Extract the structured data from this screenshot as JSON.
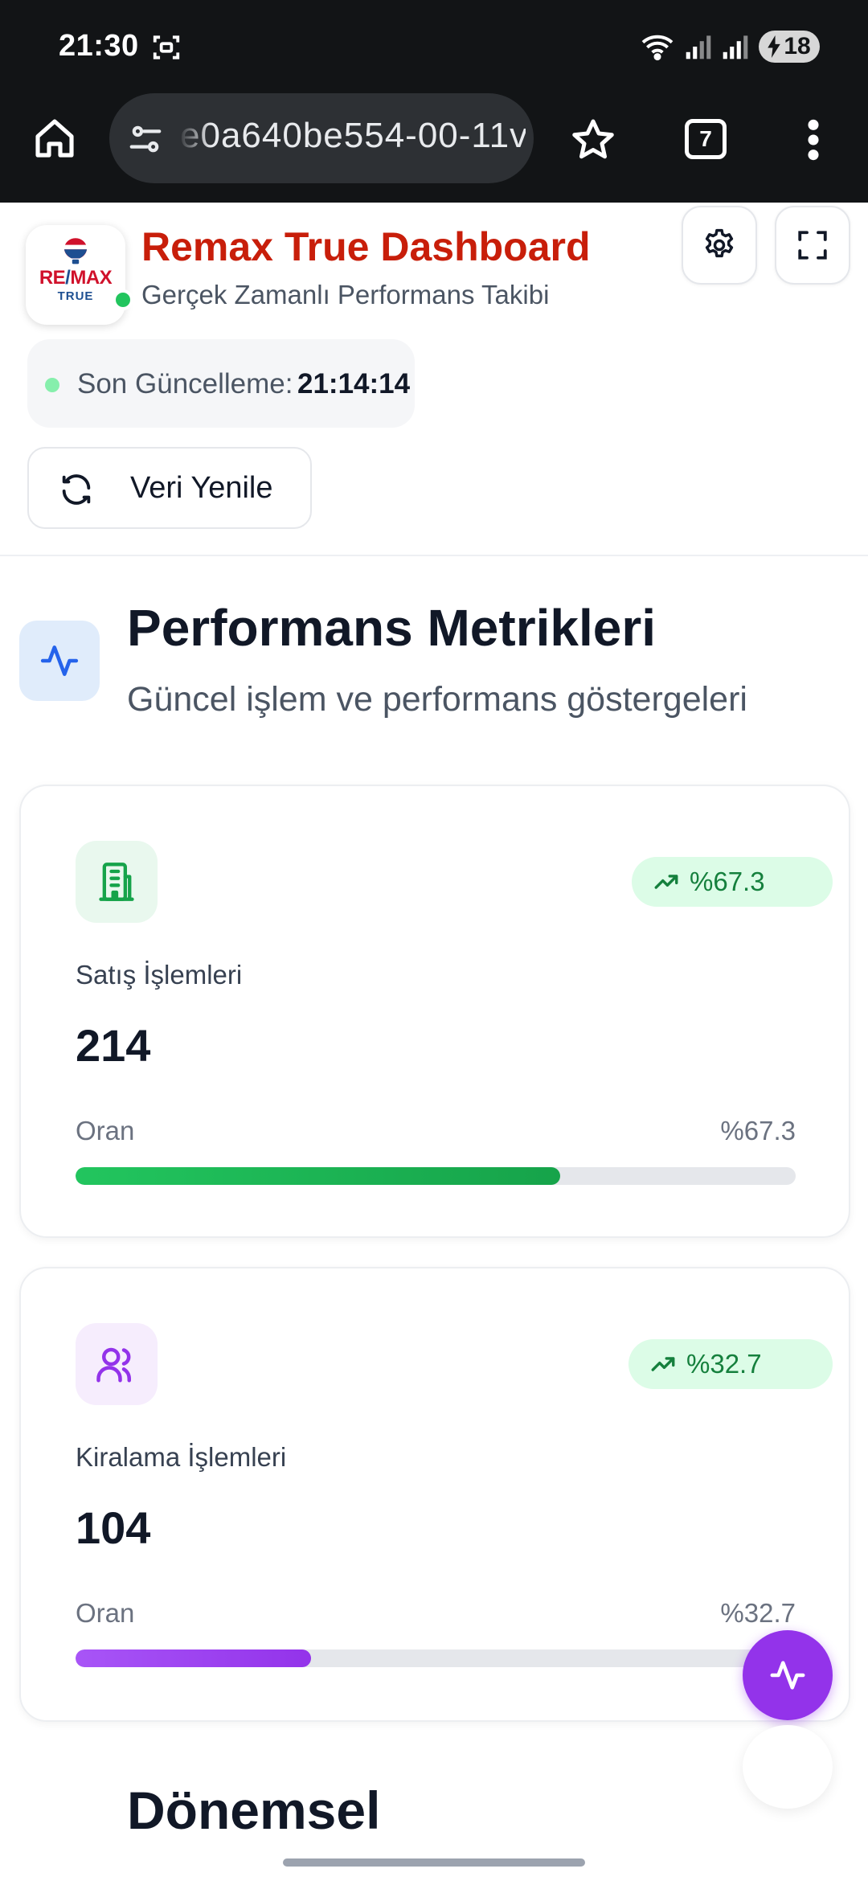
{
  "status_bar": {
    "time": "21:30",
    "battery": "18",
    "icons": [
      "screenshot-icon",
      "wifi-icon",
      "signal-icon",
      "signal-icon",
      "charging-icon"
    ]
  },
  "browser": {
    "url": "e0a640be554-00-11v",
    "tab_count": "7",
    "icons": [
      "home-icon",
      "site-settings-icon",
      "star-icon",
      "more-vert-icon"
    ]
  },
  "header": {
    "logo_re": "RE",
    "logo_slash": "/",
    "logo_max": "MAX",
    "logo_true": "TRUE",
    "title": "Remax True Dashboard",
    "subtitle": "Gerçek Zamanlı Performans Takibi",
    "last_update_label": "Son Güncelleme:",
    "last_update_value": "21:14:14",
    "refresh_label": "Veri Yenile",
    "online_color": "#22c55e",
    "brand_color": "#c81e0a"
  },
  "section": {
    "title": "Performans Metrikleri",
    "subtitle": "Güncel işlem ve performans göstergeleri",
    "icon": "activity-icon"
  },
  "metrics": [
    {
      "icon": "building-icon",
      "trend": "%67.3",
      "label": "Satış İşlemleri",
      "value": "214",
      "ratio_label": "Oran",
      "ratio_value": "%67.3",
      "progress": 0.673,
      "color": "#16a34a"
    },
    {
      "icon": "users-icon",
      "trend": "%32.7",
      "label": "Kiralama İşlemleri",
      "value": "104",
      "ratio_label": "Oran",
      "ratio_value": "%32.7",
      "progress": 0.327,
      "color": "#9333ea"
    }
  ],
  "next_section": {
    "title": "Dönemsel"
  }
}
